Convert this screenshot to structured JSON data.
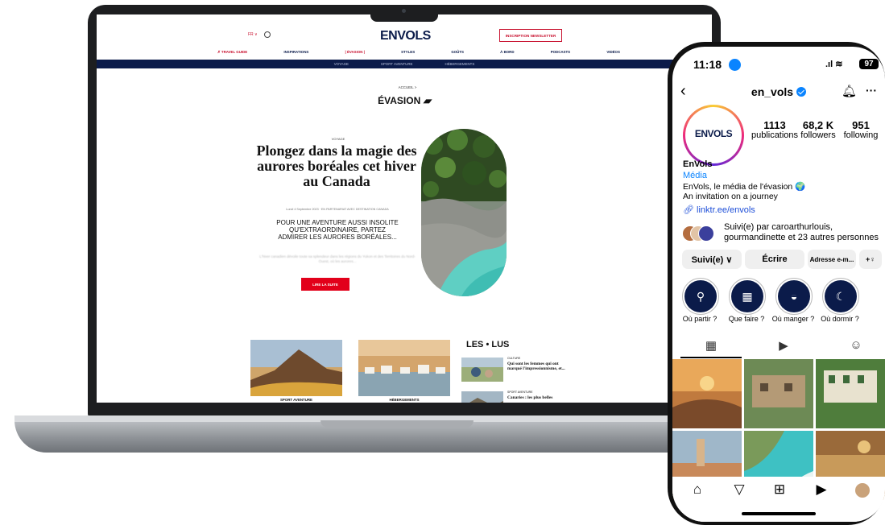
{
  "website": {
    "lang": "FR",
    "brand": "ENVOLS",
    "newsletter_button": "INSCRIPTION NEWSLETTER",
    "nav": [
      "TRAVEL GUIDE",
      "INSPIRATIONS",
      "ÉVASION",
      "STYLES",
      "GOÛTS",
      "À BORD",
      "PODCASTS",
      "VIDÉOS"
    ],
    "subnav": [
      "VOYAGE",
      "SPORT AVENTURE",
      "HÉBERGEMENTS"
    ],
    "breadcrumb": "ACCUEIL >",
    "section_title": "ÉVASION",
    "article": {
      "kicker": "VOYAGE",
      "headline": "Plongez dans la magie des aurores boréales cet hiver au Canada",
      "meta": "Lundi 4 Septembre 2023 · EN PARTENARIAT AVEC DESTINATION CANADA",
      "teaser": "POUR UNE AVENTURE AUSSI INSOLITE QU'EXTRAORDINAIRE, PARTEZ ADMIRER LES AURORES BORÉALES...",
      "blurred": "L'hiver canadien dévoile toute sa splendeur dans les régions du Yukon et des Territoires du Nord-Ouest, où les aurores...",
      "cta": "LIRE LA SUITE"
    },
    "cards": [
      "SPORT AVENTURE",
      "HÉBERGEMENTS"
    ],
    "most_read_title": "LES • LUS",
    "most_read": [
      {
        "category": "CULTURE",
        "title": "Qui sont les femmes qui ont marqué l'impressionnisme, et..."
      },
      {
        "category": "SPORT AVENTURE",
        "title": "Canaries : les plus belles"
      }
    ]
  },
  "instagram": {
    "time": "11:18",
    "battery": "97",
    "username": "en_vols",
    "avatar_logo": "ENVOLS",
    "stats": [
      {
        "value": "1113",
        "label": "publications"
      },
      {
        "value": "68,2 K",
        "label": "followers"
      },
      {
        "value": "951",
        "label": "following"
      }
    ],
    "name": "EnVols",
    "category": "Média",
    "bio": [
      "EnVols, le média de l'évasion 🌍",
      "An invitation on a journey"
    ],
    "link": "linktr.ee/envols",
    "followed_by": "Suivi(e) par caroarthurlouis, gourmandinette et 23 autres personnes",
    "buttons": [
      "Suivi(e) ∨",
      "Écrire",
      "Adresse e-m...",
      "+♀"
    ],
    "highlights": [
      "Où partir ?",
      "Que faire ?",
      "Où manger ?",
      "Où dormir ?"
    ],
    "colors": {
      "blue": "#0a84ff",
      "navy": "#0b1b4a"
    }
  }
}
